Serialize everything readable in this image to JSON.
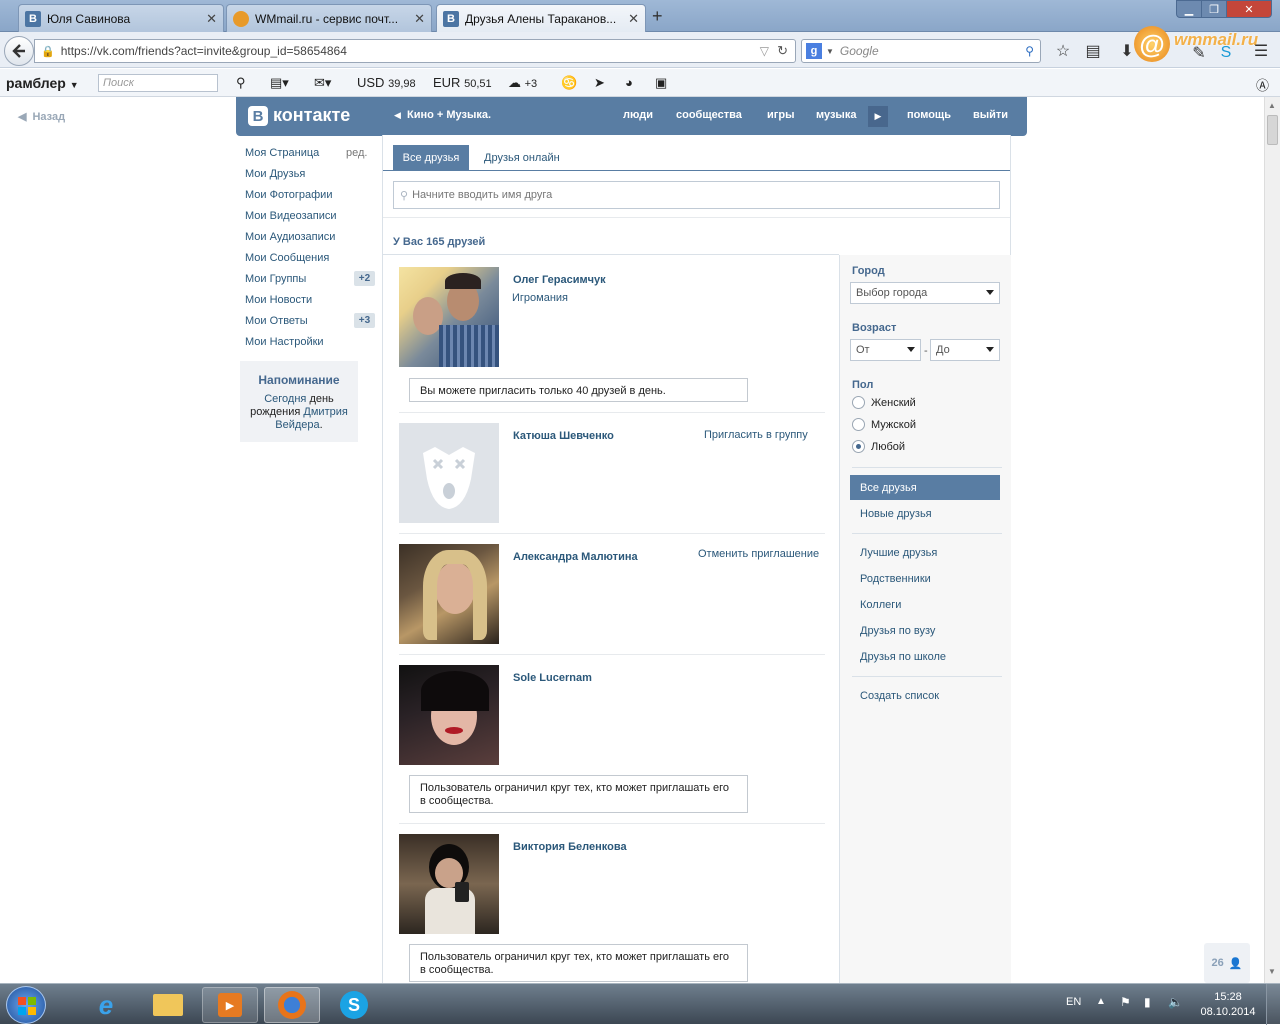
{
  "browser": {
    "tabs": [
      {
        "title": "Юля Савинова",
        "favicon": "В",
        "color": "#4c75a3"
      },
      {
        "title": "WMmail.ru - сервис почт...",
        "favicon": "W",
        "color": "#e89a2a"
      },
      {
        "title": "Друзья Алены Тараканов...",
        "favicon": "В",
        "color": "#4c75a3"
      }
    ],
    "url": "https://vk.com/friends?act=invite&group_id=58654864",
    "search_placeholder": "Google",
    "wmmail_logo": "wmmail.ru"
  },
  "rambler": {
    "brand": "рамблер",
    "search_placeholder": "Поиск",
    "usd": "USD",
    "usd_value": "39,98",
    "eur": "EUR",
    "eur_value": "50,51",
    "weather": "+3"
  },
  "page": {
    "back_label": "Назад"
  },
  "vk": {
    "logo_b": "В",
    "logo_text": "контакте",
    "crumb": "Кино + Музыка.",
    "nav": [
      "люди",
      "сообщества",
      "игры",
      "музыка",
      "помощь",
      "выйти"
    ],
    "menu": [
      {
        "label": "Моя Страница",
        "extra": "ред."
      },
      {
        "label": "Мои Друзья"
      },
      {
        "label": "Мои Фотографии"
      },
      {
        "label": "Мои Видеозаписи"
      },
      {
        "label": "Мои Аудиозаписи"
      },
      {
        "label": "Мои Сообщения"
      },
      {
        "label": "Мои Группы",
        "badge": "+2"
      },
      {
        "label": "Мои Новости"
      },
      {
        "label": "Мои Ответы",
        "badge": "+3"
      },
      {
        "label": "Мои Настройки"
      }
    ],
    "reminder": {
      "title": "Напоминание",
      "today": "Сегодня",
      "text1": "день рождения",
      "name": "Дмитрия Вейдера",
      "dot": "."
    },
    "tabs": [
      "Все друзья",
      "Друзья онлайн"
    ],
    "search_placeholder": "Начните вводить имя друга",
    "summary": "У Вас 165 друзей",
    "friends": [
      {
        "name": "Олег Герасимчук",
        "sub": "Игромания",
        "action": "",
        "notice": "Вы можете пригласить только 40 друзей в день."
      },
      {
        "name": "Катюша Шевченко",
        "sub": "",
        "action": "Пригласить в группу",
        "notice": ""
      },
      {
        "name": "Александра Малютина",
        "sub": "",
        "action": "Отменить приглашение",
        "notice": ""
      },
      {
        "name": "Sole Lucernam",
        "sub": "",
        "action": "",
        "notice": "Пользователь ограничил круг тех, кто может приглашать его в сообщества."
      },
      {
        "name": "Виктория Беленкова",
        "sub": "",
        "action": "",
        "notice": "Пользователь ограничил круг тех, кто может приглашать его в сообщества."
      }
    ],
    "filters": {
      "city_label": "Город",
      "city_value": "Выбор города",
      "age_label": "Возраст",
      "age_from": "От",
      "age_dash": "-",
      "age_to": "До",
      "sex_label": "Пол",
      "sex_options": [
        "Женский",
        "Мужской",
        "Любой"
      ],
      "sex_selected": 2,
      "lists": [
        "Все друзья",
        "Новые друзья"
      ],
      "lists2": [
        "Лучшие друзья",
        "Родственники",
        "Коллеги",
        "Друзья по вузу",
        "Друзья по школе"
      ],
      "create": "Создать список"
    },
    "online_counter": "26"
  },
  "taskbar": {
    "lang": "EN",
    "time": "15:28",
    "date": "08.10.2014"
  }
}
